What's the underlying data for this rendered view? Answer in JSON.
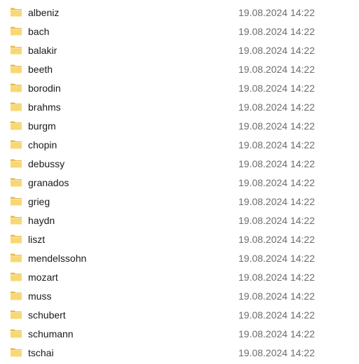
{
  "file_list": {
    "rows": [
      {
        "name": "albeniz",
        "date": "19.08.2024 14:22",
        "icon": "folder-icon"
      },
      {
        "name": "bach",
        "date": "19.08.2024 14:22",
        "icon": "folder-icon"
      },
      {
        "name": "balakir",
        "date": "19.08.2024 14:22",
        "icon": "folder-icon"
      },
      {
        "name": "beeth",
        "date": "19.08.2024 14:22",
        "icon": "folder-icon"
      },
      {
        "name": "borodin",
        "date": "19.08.2024 14:22",
        "icon": "folder-icon"
      },
      {
        "name": "brahms",
        "date": "19.08.2024 14:22",
        "icon": "folder-icon"
      },
      {
        "name": "burgm",
        "date": "19.08.2024 14:22",
        "icon": "folder-icon"
      },
      {
        "name": "chopin",
        "date": "19.08.2024 14:22",
        "icon": "folder-icon"
      },
      {
        "name": "debussy",
        "date": "19.08.2024 14:22",
        "icon": "folder-icon"
      },
      {
        "name": "granados",
        "date": "19.08.2024 14:22",
        "icon": "folder-icon"
      },
      {
        "name": "grieg",
        "date": "19.08.2024 14:22",
        "icon": "folder-icon"
      },
      {
        "name": "haydn",
        "date": "19.08.2024 14:22",
        "icon": "folder-icon"
      },
      {
        "name": "liszt",
        "date": "19.08.2024 14:22",
        "icon": "folder-icon"
      },
      {
        "name": "mendelssohn",
        "date": "19.08.2024 14:22",
        "icon": "folder-icon"
      },
      {
        "name": "mozart",
        "date": "19.08.2024 14:22",
        "icon": "folder-icon"
      },
      {
        "name": "muss",
        "date": "19.08.2024 14:22",
        "icon": "folder-icon"
      },
      {
        "name": "schubert",
        "date": "19.08.2024 14:22",
        "icon": "folder-icon"
      },
      {
        "name": "schumann",
        "date": "19.08.2024 14:22",
        "icon": "folder-icon"
      },
      {
        "name": "tschai",
        "date": "19.08.2024 14:22",
        "icon": "folder-icon"
      }
    ]
  },
  "colors": {
    "folder_front": "#F8D775",
    "folder_back": "#E8B84A",
    "text": "#1a1a1a",
    "date_text": "#6d6d6d"
  }
}
